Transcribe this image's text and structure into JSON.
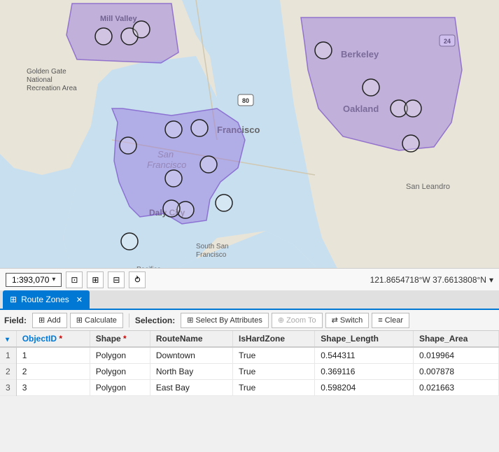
{
  "map": {
    "scale": "1:393,070",
    "coordinates": "121.8654718°W 37.6613808°N",
    "coordinate_chevron": "▾",
    "scale_chevron": "▾"
  },
  "tabs": [
    {
      "id": "route-zones",
      "label": "Route Zones",
      "icon": "⊞",
      "active": true
    }
  ],
  "toolbar": {
    "field_label": "Field:",
    "add_label": "Add",
    "calculate_label": "Calculate",
    "selection_label": "Selection:",
    "select_by_attr_label": "Select By Attributes",
    "zoom_to_label": "Zoom To",
    "switch_label": "Switch",
    "clear_label": "Clear"
  },
  "table": {
    "columns": [
      {
        "id": "objectid",
        "label": "ObjectID",
        "asterisk": true,
        "sortable": true
      },
      {
        "id": "shape",
        "label": "Shape",
        "asterisk": true
      },
      {
        "id": "routename",
        "label": "RouteName"
      },
      {
        "id": "ishardzone",
        "label": "IsHardZone"
      },
      {
        "id": "shape_length",
        "label": "Shape_Length"
      },
      {
        "id": "shape_area",
        "label": "Shape_Area"
      }
    ],
    "rows": [
      {
        "rownum": "1",
        "objectid": "1",
        "shape": "Polygon",
        "routename": "Downtown",
        "ishardzone": "True",
        "shape_length": "0.544311",
        "shape_area": "0.019964"
      },
      {
        "rownum": "2",
        "objectid": "2",
        "shape": "Polygon",
        "routename": "North Bay",
        "ishardzone": "True",
        "shape_length": "0.369116",
        "shape_area": "0.007878"
      },
      {
        "rownum": "3",
        "objectid": "3",
        "shape": "Polygon",
        "routename": "East Bay",
        "ishardzone": "True",
        "shape_length": "0.598204",
        "shape_area": "0.021663"
      }
    ]
  },
  "icons": {
    "table_icon": "⊞",
    "add_icon": "⊞",
    "calculate_icon": "⊞",
    "select_attr_icon": "⊞",
    "zoom_icon": "⊕",
    "switch_icon": "⇄",
    "clear_icon": "≡",
    "scale_tools_icon": "⊞",
    "close_icon": "✕",
    "sort_down": "▾"
  },
  "colors": {
    "polygon_fill": "rgba(147, 112, 219, 0.45)",
    "polygon_stroke": "rgba(120, 80, 200, 0.7)",
    "circle_fill": "rgba(255,255,255,0.3)",
    "circle_stroke": "#333",
    "tab_active": "#0078d4",
    "accent": "#0078d4"
  }
}
